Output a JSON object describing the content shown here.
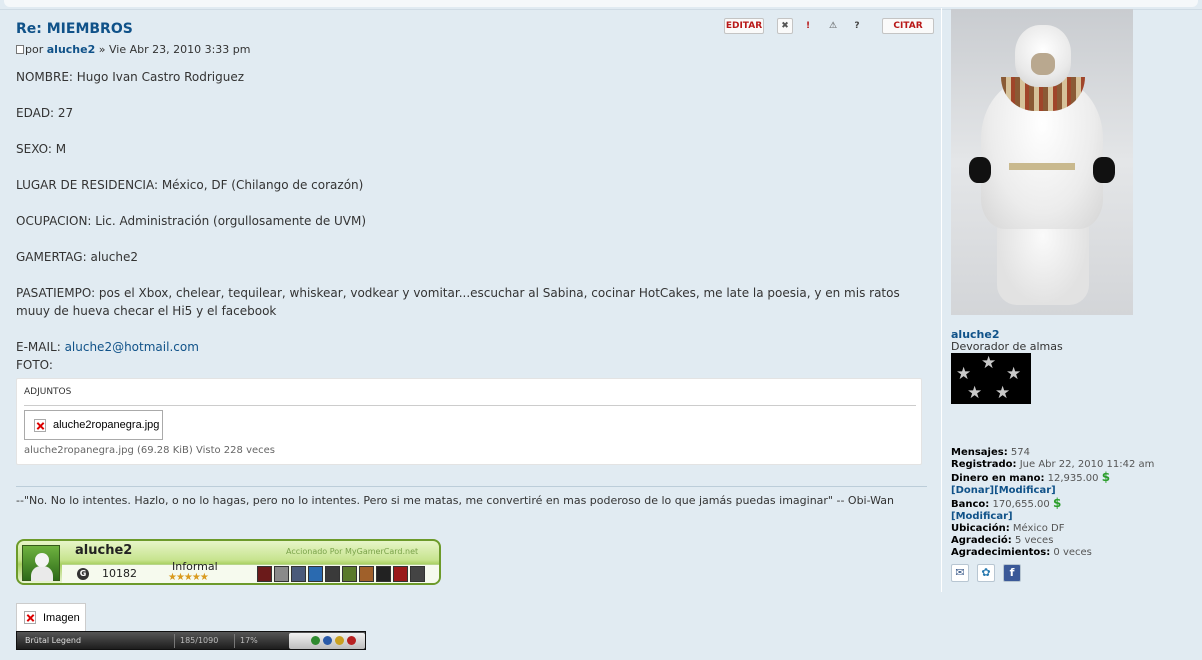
{
  "post": {
    "title": "Re: MIEMBROS",
    "actions": {
      "edit": "EDITAR",
      "delete": "✖",
      "report": "!",
      "warn": "⚠",
      "info": "?",
      "quote": "CITAR"
    },
    "author_prefix": "por",
    "author": "aluche2",
    "date_sep": " » ",
    "date": "Vie Abr 23, 2010 3:33 pm",
    "lines": {
      "nombre": "NOMBRE: Hugo Ivan Castro Rodriguez",
      "edad": "EDAD: 27",
      "sexo": "SEXO: M",
      "residencia": "LUGAR DE RESIDENCIA: México, DF (Chilango de corazón)",
      "ocupacion": "OCUPACION: Lic. Administración (orgullosamente de UVM)",
      "gamertag": "GAMERTAG: aluche2",
      "pasatiempo": "PASATIEMPO: pos el Xbox, chelear, tequilear, whiskear, vodkear y vomitar...escuchar al Sabina, cocinar HotCakes, me late la poesia, y en mis ratos muuy de hueva checar el Hi5 y el facebook",
      "email_label": "E-MAIL: ",
      "email": "aluche2@hotmail.com",
      "foto": "FOTO:"
    },
    "attachments": {
      "header": "ADJUNTOS",
      "file_name": "aluche2ropanegra.jpg",
      "meta": "aluche2ropanegra.jpg (69.28 KiB) Visto 228 veces"
    },
    "signature": "--\"No. No lo intentes. Hazlo, o no lo hagas, pero no lo intentes. Pero si me matas, me convertiré en mas poderoso de lo que jamás puedas imaginar\" -- Obi-Wan",
    "gamercard": {
      "gamertag": "aluche2",
      "powered_by": "Accionado Por MyGamerCard.net",
      "gamerscore": "10182",
      "zone": "Informal",
      "reputation": "★★★★★",
      "gamerscore_icon": "G"
    },
    "image_placeholder": "Imagen",
    "xbox_bar": {
      "game": "Brütal Legend",
      "achievements": "185/1090",
      "percent": "17%"
    }
  },
  "profile": {
    "username": "aluche2",
    "rank_title": "Devorador de almas",
    "stats": {
      "mensajes_label": "Mensajes:",
      "mensajes": "574",
      "registrado_label": "Registrado:",
      "registrado": "Jue Abr 22, 2010 11:42 am",
      "dinero_label": "Dinero en mano:",
      "dinero": "12,935.00",
      "currency": "$",
      "donar": "[Donar]",
      "modificar": "[Modificar]",
      "banco_label": "Banco:",
      "banco": "170,655.00",
      "modificar2": "[Modificar]",
      "ubicacion_label": "Ubicación:",
      "ubicacion": "México DF",
      "agradecio_label": "Agradeció:",
      "agradecio": "5 veces",
      "agradecimientos_label": "Agradecimientos:",
      "agradecimientos": "0 veces"
    },
    "contact_icons": [
      "email-icon",
      "msn-icon",
      "facebook-icon"
    ]
  },
  "colors": {
    "background": "#e1ebf2",
    "link": "#105289",
    "button_text": "#b81818",
    "money": "#2a9d2a"
  }
}
